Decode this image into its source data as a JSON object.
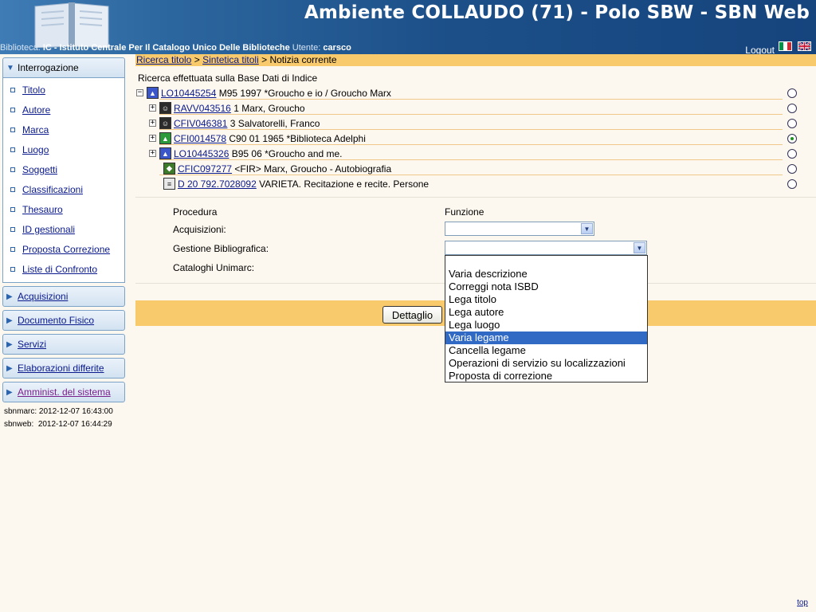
{
  "header": {
    "title": "Ambiente COLLAUDO (71) - Polo SBW - SBN Web",
    "library_label": "Biblioteca:",
    "library_value": "IC - Istituto Centrale Per Il Catalogo Unico Delle Biblioteche",
    "user_label": "Utente:",
    "user_value": "carsco",
    "logout": "Logout"
  },
  "sidebar": {
    "open_section": "Interrogazione",
    "items": [
      "Titolo",
      "Autore",
      "Marca",
      "Luogo",
      "Soggetti",
      "Classificazioni",
      "Thesauro",
      "ID gestionali",
      "Proposta Correzione",
      "Liste di Confronto"
    ],
    "sections": [
      "Acquisizioni",
      "Documento Fisico",
      "Servizi",
      "Elaborazioni differite",
      "Amminist. del sistema"
    ],
    "timestamps": [
      {
        "label": "sbnmarc:",
        "value": "2012-12-07 16:43:00"
      },
      {
        "label": "sbnweb:",
        "value": "2012-12-07 16:44:29"
      }
    ]
  },
  "breadcrumb": {
    "link1": "Ricerca titolo",
    "sep1": ">",
    "link2": "Sintetica titoli",
    "sep2": ">",
    "current": "Notizia corrente"
  },
  "search_info": "Ricerca effettuata sulla Base Dati di Indice",
  "tree": [
    {
      "code": "LO10445254",
      "text": "M95 1997 *Groucho e io / Groucho Marx",
      "expander": "−",
      "icon": "book-icon",
      "selected": false
    },
    {
      "code": "RAVV043516",
      "text": "1 Marx, Groucho",
      "expander": "+",
      "icon": "author-icon",
      "selected": false
    },
    {
      "code": "CFIV046381",
      "text": "3 Salvatorelli, Franco",
      "expander": "+",
      "icon": "author-icon",
      "selected": false
    },
    {
      "code": "CFI0014578",
      "text": "C90 01 1965 *Biblioteca Adelphi",
      "expander": "+",
      "icon": "collection-icon",
      "selected": true
    },
    {
      "code": "LO10445326",
      "text": "B95 06 *Groucho and me.",
      "expander": "+",
      "icon": "book-icon",
      "selected": false
    },
    {
      "code": "CFIC097277",
      "text": "<FIR> Marx, Groucho - Autobiografia",
      "expander": "",
      "icon": "subject-icon",
      "selected": false
    },
    {
      "code": "D 20 792.7028092",
      "text": "VARIETA. Recitazione e recite. Persone",
      "expander": "",
      "icon": "classification-icon",
      "selected": false
    }
  ],
  "form": {
    "col_procedura": "Procedura",
    "col_funzione": "Funzione",
    "acquisizioni_label": "Acquisizioni:",
    "gestione_label": "Gestione Bibliografica:",
    "cataloghi_label": "Cataloghi Unimarc:",
    "acquisizioni_value": "",
    "gestione_value": ""
  },
  "dropdown_options": [
    "Varia descrizione",
    "Correggi nota ISBD",
    "Lega titolo",
    "Lega autore",
    "Lega luogo",
    "Varia legame",
    "Cancella legame",
    "Operazioni di servizio su localizzazioni",
    "Proposta di correzione"
  ],
  "dropdown_selected_index": 5,
  "detail_button": "Dettaglio",
  "top_link": "top",
  "colors": {
    "header_blue": "#1c4f88",
    "band_orange": "#f8ca6b",
    "selection_blue": "#316ac5",
    "link": "#0a1a8c"
  }
}
